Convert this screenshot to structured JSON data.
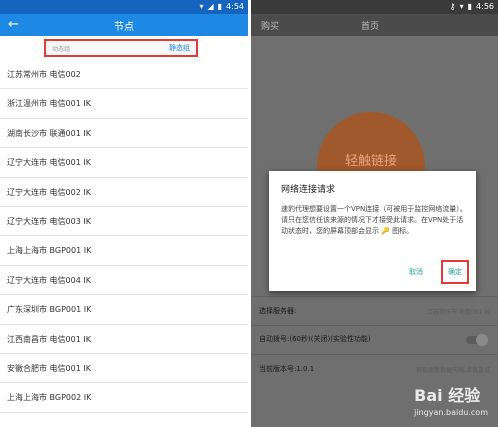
{
  "left": {
    "status": {
      "time": "4:54"
    },
    "appbar": {
      "back": "←",
      "title": "节点"
    },
    "search": {
      "placeholder": "动态组",
      "filter": "静态组"
    },
    "nodes": [
      "江苏常州市 电信002",
      "浙江温州市 电信001 IK",
      "湖南长沙市 联通001 IK",
      "辽宁大连市 电信001 IK",
      "辽宁大连市 电信002 IK",
      "辽宁大连市 电信003 IK",
      "上海上海市 BGP001 IK",
      "辽宁大连市 电信004 IK",
      "广东深圳市 BGP001 IK",
      "江西南昌市 电信001 IK",
      "安徽合肥市 电信001 IK",
      "上海上海市 BGP002 IK"
    ]
  },
  "right": {
    "status": {
      "time": "4:56"
    },
    "appbar": {
      "buy": "购买",
      "home": "首页"
    },
    "connect_label": "轻触链接",
    "dialog": {
      "title": "网络连接请求",
      "body": "速豹代理想要设置一个VPN连接（可被用于监控网络流量）。请只在您信任该来源的情况下才接受此请求。在VPN处于活动状态时，您的屏幕顶部会显示 🔑 图标。",
      "cancel": "取消",
      "ok": "确定"
    },
    "server_label": "选择服务器:",
    "server_value": "江苏常州市 电信001 IK",
    "auto_dial": "自动拨号:(60秒)(关闭)(实验性功能)",
    "version": "当前版本号:1.0.1",
    "version_note": "获取更新数据失败,点我重试"
  },
  "watermark": {
    "brand": "Bai 经验",
    "url": "jingyan.baidu.com"
  }
}
